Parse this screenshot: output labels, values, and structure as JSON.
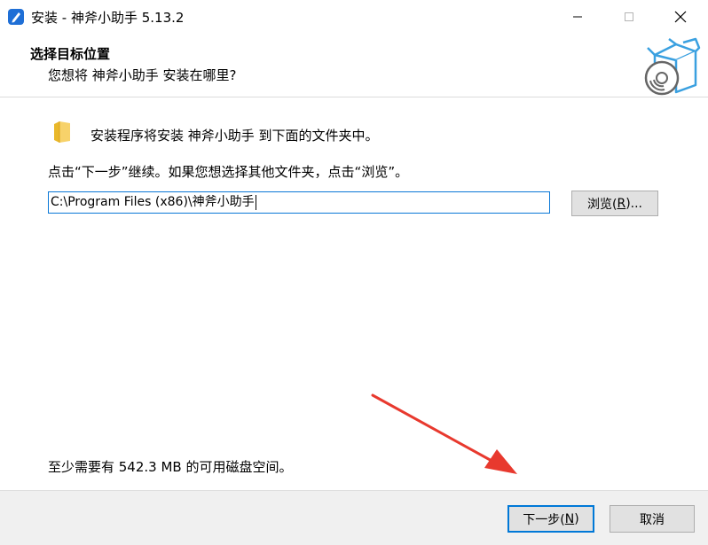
{
  "window": {
    "title": "安装 - 神斧小助手 5.13.2",
    "controls": [
      "minimize",
      "maximize",
      "close"
    ]
  },
  "header": {
    "title": "选择目标位置",
    "subtitle": "您想将 神斧小助手 安装在哪里?"
  },
  "main": {
    "intro": "安装程序将安装 神斧小助手 到下面的文件夹中。",
    "instruction": "点击“下一步”继续。如果您想选择其他文件夹，点击“浏览”。",
    "install_path": "C:\\Program Files (x86)\\神斧小助手",
    "browse_label_prefix": "浏览(",
    "browse_accel": "R",
    "browse_label_suffix": ")...",
    "disk_space": "至少需要有 542.3 MB 的可用磁盘空间。"
  },
  "footer": {
    "next_label_prefix": "下一步(",
    "next_accel": "N",
    "next_label_suffix": ")",
    "cancel_label": "取消"
  },
  "colors": {
    "accent": "#0078d7",
    "arrow": "#e8392e",
    "footer_bg": "#f0f0f0",
    "button_bg": "#e1e1e1"
  },
  "icons": {
    "app": "pen-app-icon",
    "header": "software-box-cd-icon",
    "folder": "folder-icon"
  }
}
